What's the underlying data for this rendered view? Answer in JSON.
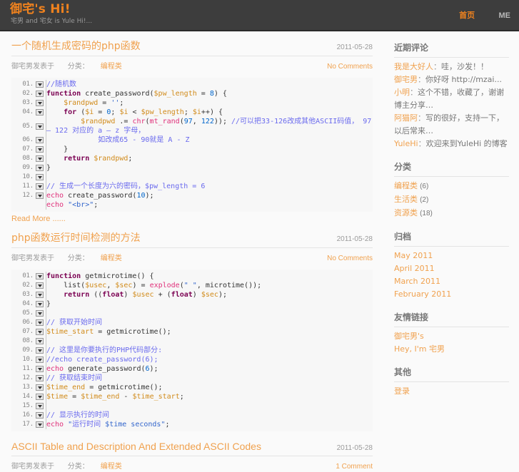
{
  "header": {
    "site_title": "御宅's Hi!",
    "tagline": "宅男 and 宅女 is Yule Hi!...",
    "nav": [
      {
        "label": "首页",
        "state": "active",
        "name": "nav-home"
      },
      {
        "label": "ME",
        "state": "link",
        "name": "nav-me"
      }
    ]
  },
  "posts": [
    {
      "title": "一个随机生成密码的php函数",
      "date": "2011-05-28",
      "meta_author": "御宅男发表于",
      "meta_cat_prefix": "分类：",
      "meta_cat_link": "编程类",
      "comments": "No Comments",
      "read_more": "Read More ......",
      "code_lines": [
        "01.",
        "02.",
        "03.",
        "04.",
        "05.",
        "06.",
        "07.",
        "08.",
        "09.",
        "10.",
        "11.",
        "12."
      ],
      "code_html": "<span class=\"c\">//随机数</span>\n<span class=\"k\">function</span> <span class=\"p\">create_password(</span><span class=\"v\">$pw_length</span> <span class=\"p\">=</span> <span class=\"n\">8</span><span class=\"p\">) {</span>\n    <span class=\"v\">$randpwd</span> <span class=\"p\">=</span> <span class=\"s\">''</span><span class=\"p\">;</span>\n    <span class=\"k\">for</span> <span class=\"p\">(</span><span class=\"v\">$i</span> <span class=\"p\">=</span> <span class=\"n\">0</span><span class=\"p\">;</span> <span class=\"v\">$i</span> <span class=\"p\">&lt;</span> <span class=\"v\">$pw_length</span><span class=\"p\">;</span> <span class=\"v\">$i</span><span class=\"p\">++) {</span>\n        <span class=\"v\">$randpwd</span> <span class=\"p\">.=</span> <span class=\"f\">chr</span><span class=\"p\">(</span><span class=\"f\">mt_rand</span><span class=\"p\">(</span><span class=\"n\">97</span><span class=\"p\">,</span> <span class=\"n\">122</span><span class=\"p\">));</span> <span class=\"c\">//可以把33-126改成其他ASCII码值， 97 – 122 对应的 a – z 字母，</span>\n            <span class=\"c\">如改成65 - 90就是 A - Z</span>\n    <span class=\"p\">}</span>\n    <span class=\"k\">return</span> <span class=\"v\">$randpwd</span><span class=\"p\">;</span>\n<span class=\"p\">}</span>\n\n<span class=\"c\">// 生成一个长度为六的密码，$pw_length = 6</span>\n<span class=\"f\">echo</span> <span class=\"p\">create_password(</span><span class=\"n\">10</span><span class=\"p\">);</span>\n<span class=\"f\">echo</span> <span class=\"s\">\"&lt;br&gt;\"</span><span class=\"p\">;</span>"
    },
    {
      "title": "php函数运行时间检测的方法",
      "date": "2011-05-28",
      "meta_author": "御宅男发表于",
      "meta_cat_prefix": "分类：",
      "meta_cat_link": "编程类",
      "comments": "No Comments",
      "read_more": "",
      "code_lines": [
        "01.",
        "02.",
        "03.",
        "04.",
        "05.",
        "06.",
        "07.",
        "08.",
        "09.",
        "10.",
        "11.",
        "12.",
        "13.",
        "14.",
        "15.",
        "16.",
        "17."
      ],
      "code_html": "<span class=\"k\">function</span> <span class=\"p\">getmicrotime() {</span>\n    <span class=\"p\">list(</span><span class=\"v\">$usec</span><span class=\"p\">,</span> <span class=\"v\">$sec</span><span class=\"p\">) =</span> <span class=\"f\">explode</span><span class=\"p\">(</span><span class=\"s\">\" \"</span><span class=\"p\">,</span> <span class=\"p\">microtime());</span>\n    <span class=\"k\">return</span> <span class=\"p\">((</span><span class=\"k\">float</span><span class=\"p\">)</span> <span class=\"v\">$usec</span> <span class=\"p\">+ (</span><span class=\"k\">float</span><span class=\"p\">)</span> <span class=\"v\">$sec</span><span class=\"p\">);</span>\n<span class=\"p\">}</span>\n\n<span class=\"c\">// 获取开始时间</span>\n<span class=\"v\">$time_start</span> <span class=\"p\">= getmicrotime();</span>\n\n<span class=\"c\">// 这里是你要执行的PHP代码部分:</span>\n<span class=\"c\">//echo create_password(6);</span>\n<span class=\"f\">echo</span> <span class=\"p\">generate_password(</span><span class=\"n\">6</span><span class=\"p\">);</span>\n<span class=\"c\">// 获取结束时间</span>\n<span class=\"v\">$time_end</span> <span class=\"p\">= getmicrotime();</span>\n<span class=\"v\">$time</span> <span class=\"p\">=</span> <span class=\"v\">$time_end</span> <span class=\"p\">-</span> <span class=\"v\">$time_start</span><span class=\"p\">;</span>\n\n<span class=\"c\">// 显示执行的时间</span>\n<span class=\"f\">echo</span> <span class=\"s\">\"</span><span class=\"c\">运行时间</span><span class=\"s\"> $time seconds\"</span><span class=\"p\">;</span>"
    },
    {
      "title": "ASCII Table and Description And Extended ASCII Codes",
      "date": "2011-05-28",
      "meta_author": "御宅男发表于",
      "meta_cat_prefix": "分类：",
      "meta_cat_link": "编程类",
      "comments": "1 Comment",
      "read_more": "",
      "code_lines": [],
      "code_html": ""
    }
  ],
  "sidebar": {
    "widgets": [
      {
        "title": "近期评论",
        "type": "comments",
        "items": [
          {
            "author": "我是大好人",
            "sep": "：",
            "body": "哇，沙发！！"
          },
          {
            "author": "御宅男",
            "sep": "：",
            "body": "你好呀 http://mzai..."
          },
          {
            "author": "小明",
            "sep": "：",
            "body": "这个不错，收藏了，谢谢博主分享…"
          },
          {
            "author": "阿猫阿",
            "sep": "：",
            "body": "写的很好，支持一下，以后常来…"
          },
          {
            "author": "YuleHi",
            "sep": "：",
            "body": "欢迎来到YuleHi 的博客"
          }
        ]
      },
      {
        "title": "分类",
        "type": "categories",
        "items": [
          {
            "label": "编程类",
            "count": "(6)"
          },
          {
            "label": "生活类",
            "count": "(2)"
          },
          {
            "label": "资源类",
            "count": "(18)"
          }
        ]
      },
      {
        "title": "归档",
        "type": "links",
        "items": [
          {
            "label": "May 2011"
          },
          {
            "label": "April 2011"
          },
          {
            "label": "March 2011"
          },
          {
            "label": "February 2011"
          }
        ]
      },
      {
        "title": "友情链接",
        "type": "links",
        "items": [
          {
            "label": "御宅男's"
          },
          {
            "label": "Hey, I'm 宅男"
          }
        ]
      },
      {
        "title": "其他",
        "type": "links",
        "items": [
          {
            "label": "登录"
          }
        ]
      }
    ]
  },
  "colors": {
    "accent": "#f0821e",
    "link": "#f0a14e",
    "header_bg": "#3d3d3d",
    "page_bg": "#fafafa",
    "code_bg": "#f7f7f7"
  }
}
